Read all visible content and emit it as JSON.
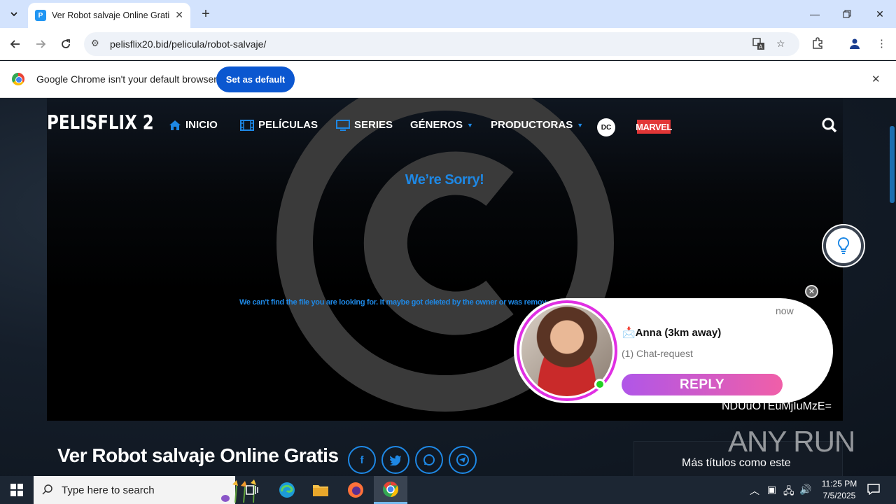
{
  "browser": {
    "tab_title": "Ver Robot salvaje Online Gratis",
    "favicon_letter": "P",
    "url": "pelisflix20.bid/pelicula/robot-salvaje/",
    "infobar_message": "Google Chrome isn't your default browser",
    "set_default_label": "Set as default"
  },
  "site": {
    "logo": "PELISFLIX 2",
    "nav": [
      {
        "label": "INICIO",
        "icon": "home-icon"
      },
      {
        "label": "PELÍCULAS",
        "icon": "film-icon"
      },
      {
        "label": "SERIES",
        "icon": "tv-icon"
      },
      {
        "label": "GÉNEROS",
        "icon": "caret-down-icon"
      },
      {
        "label": "PRODUCTORAS",
        "icon": "caret-down-icon"
      }
    ],
    "dc_logo": "DC",
    "marvel_logo": "MARVEL"
  },
  "player": {
    "error_title": "We’re Sorry!",
    "error_message": "We can't find the file you are looking for. It maybe got deleted by the owner or was removed due a copyright violation.",
    "overlay_code": "NDUuOTEuMjIuMzE="
  },
  "chat_popup": {
    "name": "📩Anna (3km away)",
    "subtitle": "(1) Chat-request",
    "time": "now",
    "reply_label": "REPLY"
  },
  "movie": {
    "title": "Ver Robot salvaje Online Gratis",
    "share": [
      "facebook-icon",
      "twitter-icon",
      "whatsapp-icon",
      "telegram-icon"
    ],
    "side_title": "Más títulos como este"
  },
  "watermark": "ANY RUN",
  "taskbar": {
    "search_placeholder": "Type here to search",
    "time": "11:25 PM",
    "date": "7/5/2025"
  },
  "colors": {
    "accent": "#1e88e5",
    "popup_ring": "#e02fe3",
    "reply_gradient_start": "#b056e8",
    "reply_gradient_end": "#f05fa8"
  }
}
